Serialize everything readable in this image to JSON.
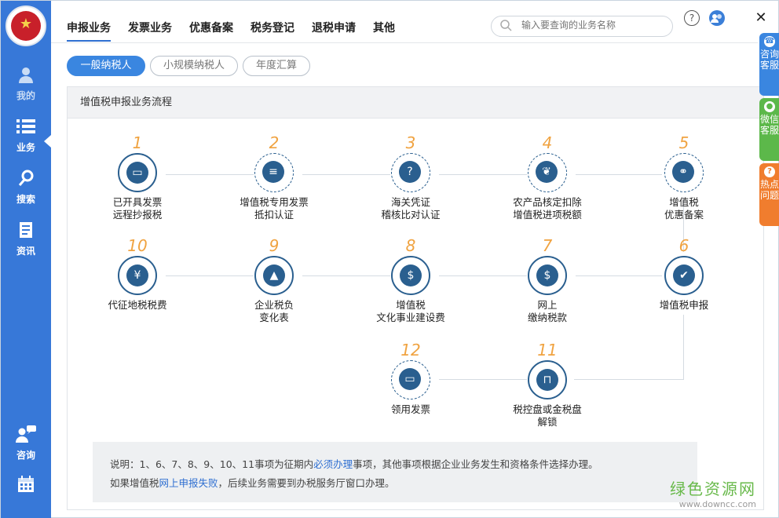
{
  "sidebar": {
    "items": [
      {
        "label": "我的",
        "icon": "user-icon"
      },
      {
        "label": "业务",
        "icon": "list-icon"
      },
      {
        "label": "搜索",
        "icon": "search-icon"
      },
      {
        "label": "资讯",
        "icon": "document-icon"
      },
      {
        "label": "咨询",
        "icon": "chat-user-icon"
      },
      {
        "label": "",
        "icon": "calendar-icon"
      }
    ]
  },
  "topnav": [
    "申报业务",
    "发票业务",
    "优惠备案",
    "税务登记",
    "退税申请",
    "其他"
  ],
  "search": {
    "placeholder": "输入要查询的业务名称"
  },
  "tabs": [
    "一般纳税人",
    "小规模纳税人",
    "年度汇算"
  ],
  "panel_title": "增值税申报业务流程",
  "steps": [
    {
      "num": "1",
      "lines": [
        "已开具发票",
        "远程抄报税"
      ],
      "icon": "laptop-icon"
    },
    {
      "num": "2",
      "lines": [
        "增值税专用发票",
        "抵扣认证"
      ],
      "icon": "file-icon"
    },
    {
      "num": "3",
      "lines": [
        "海关凭证",
        "稽核比对认证"
      ],
      "icon": "question-file-icon"
    },
    {
      "num": "4",
      "lines": [
        "农产品核定扣除",
        "增值税进项税额"
      ],
      "icon": "leaf-icon"
    },
    {
      "num": "5",
      "lines": [
        "增值税",
        "优惠备案"
      ],
      "icon": "link-file-icon"
    },
    {
      "num": "6",
      "lines": [
        "增值税申报"
      ],
      "icon": "checkmark-icon"
    },
    {
      "num": "7",
      "lines": [
        "网上",
        "缴纳税款"
      ],
      "icon": "money-bag-icon"
    },
    {
      "num": "8",
      "lines": [
        "增值税",
        "文化事业建设费"
      ],
      "icon": "coin-stack-icon"
    },
    {
      "num": "9",
      "lines": [
        "企业税负",
        "变化表"
      ],
      "icon": "chart-icon"
    },
    {
      "num": "10",
      "lines": [
        "代征地税税费"
      ],
      "icon": "coins-icon"
    },
    {
      "num": "11",
      "lines": [
        "税控盘或金税盘",
        "解锁"
      ],
      "icon": "unlock-icon"
    },
    {
      "num": "12",
      "lines": [
        "领用发票"
      ],
      "icon": "monitor-icon"
    }
  ],
  "note": {
    "line1_a": "说明：1、6、7、8、9、10、11事项为征期内",
    "line1_link": "必须办理",
    "line1_b": "事项，其他事项根据企业业务发生和资格条件选择办理。",
    "line2_a": "如果增值税",
    "line2_link": "网上申报失败",
    "line2_b": "，后续业务需要到办税服务厅窗口办理。"
  },
  "float_tabs": [
    {
      "label": "咨询客服",
      "color": "#3a86e0",
      "icon": "headset-icon",
      "glyph": "☎"
    },
    {
      "label": "微信客服",
      "color": "#5cb84a",
      "icon": "wechat-icon",
      "glyph": "●"
    },
    {
      "label": "热点问题",
      "color": "#f07d2e",
      "icon": "question-icon",
      "glyph": "?"
    }
  ],
  "watermark": {
    "title": "绿色资源网",
    "url": "www.downcc.com"
  },
  "colors": {
    "sidebar": "#3778d8",
    "accent": "#2f6fd1",
    "step_number": "#f0a341",
    "icon_dark": "#2a5f8f"
  }
}
